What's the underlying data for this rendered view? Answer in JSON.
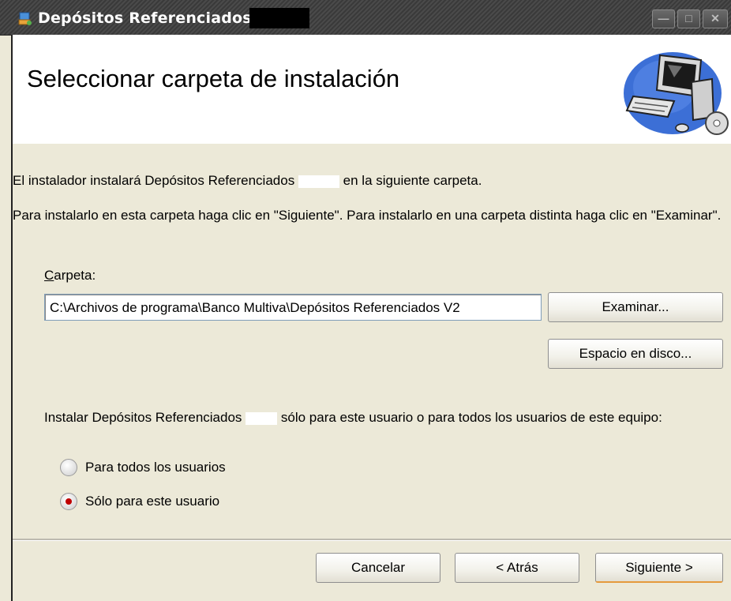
{
  "window": {
    "title": "Depósitos Referenciados",
    "controls": {
      "minimize": "—",
      "maximize": "□",
      "close": "✕"
    }
  },
  "banner": {
    "heading": "Seleccionar carpeta de instalación"
  },
  "intro": {
    "line1_before": "El instalador instalará Depósitos Referenciados",
    "line1_after": "en la siguiente carpeta.",
    "line2": "Para instalarlo en esta carpeta haga clic en \"Siguiente\". Para instalarlo en una carpeta distinta haga clic en \"Examinar\"."
  },
  "folder": {
    "label_access": "C",
    "label_rest": "arpeta:",
    "value": "C:\\Archivos de programa\\Banco Multiva\\Depósitos Referenciados V2",
    "browse_button": "Examinar...",
    "disk_space_button": "Espacio en disco..."
  },
  "scope": {
    "prompt_before": "Instalar Depósitos Referenciados",
    "prompt_after": "sólo para este usuario o para todos los usuarios de este equipo:",
    "options": [
      {
        "label": "Para todos los usuarios",
        "selected": false
      },
      {
        "label": "Sólo para este usuario",
        "selected": true
      }
    ]
  },
  "footer": {
    "cancel": "Cancelar",
    "back": "< Atrás",
    "next": "Siguiente >"
  },
  "colors": {
    "radio_selected": "#c00000",
    "dialog_bg": "#ece9d8"
  }
}
